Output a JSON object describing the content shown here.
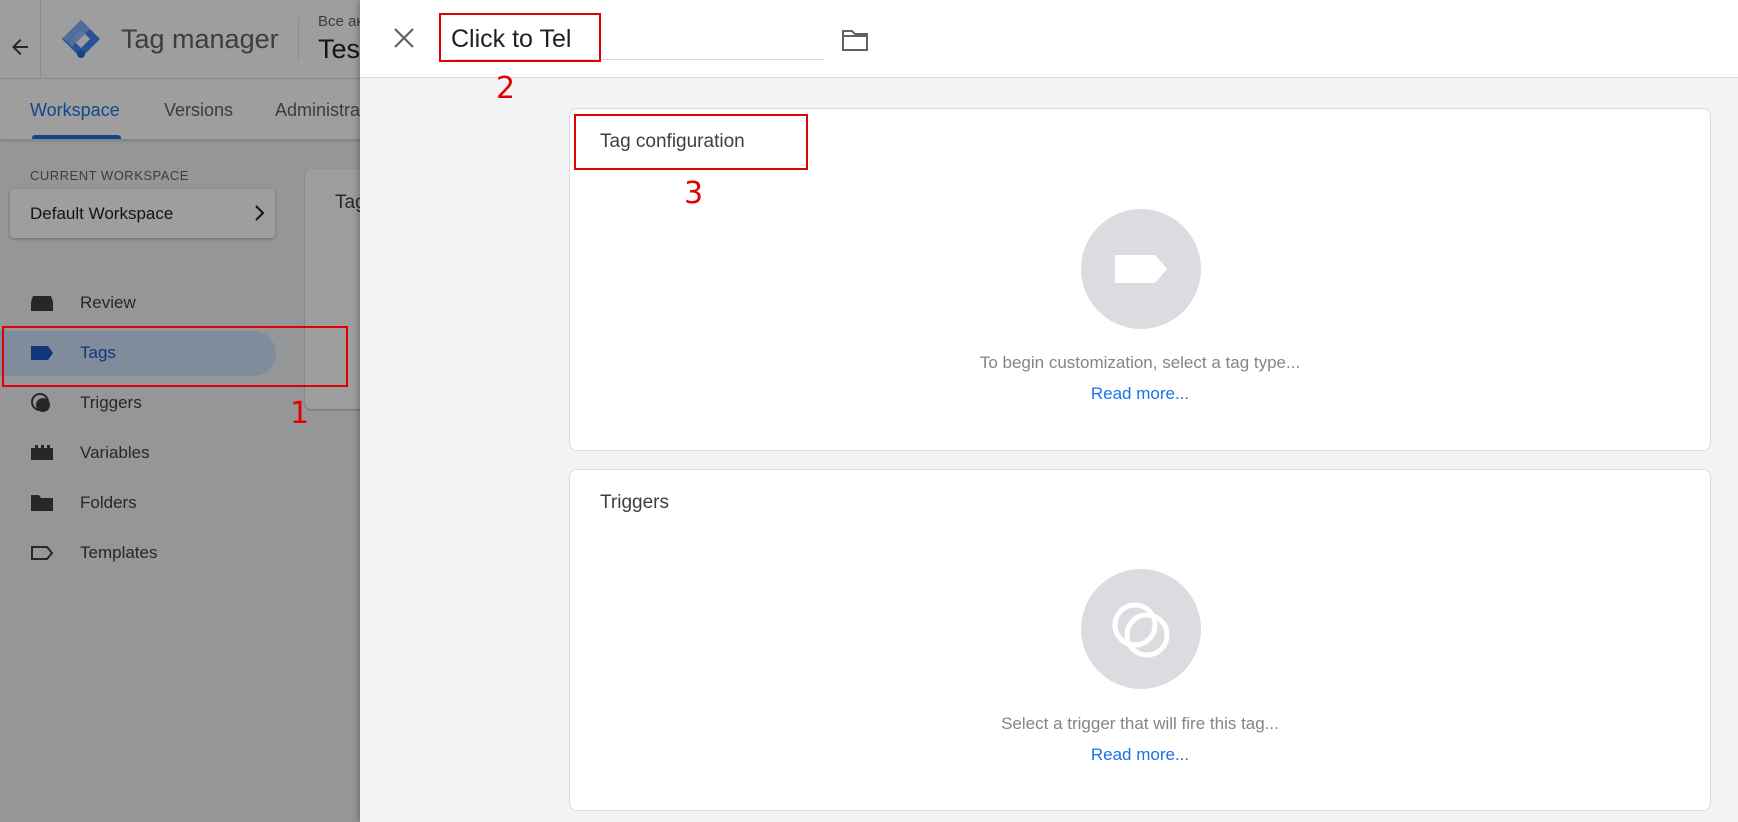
{
  "app": {
    "name": "Tag manager",
    "account_small": "Все ак",
    "account_big": "Tes"
  },
  "tabs": [
    {
      "label": "Workspace",
      "active": true
    },
    {
      "label": "Versions",
      "active": false
    },
    {
      "label": "Administra",
      "active": false
    }
  ],
  "workspace": {
    "label": "CURRENT WORKSPACE",
    "name": "Default Workspace"
  },
  "nav": [
    {
      "label": "Review",
      "icon": "review-icon"
    },
    {
      "label": "Tags",
      "icon": "tag-icon",
      "active": true
    },
    {
      "label": "Triggers",
      "icon": "trigger-icon"
    },
    {
      "label": "Variables",
      "icon": "variables-icon"
    },
    {
      "label": "Folders",
      "icon": "folder-icon"
    },
    {
      "label": "Templates",
      "icon": "template-icon"
    }
  ],
  "bg_card": {
    "title": "Tag"
  },
  "editor": {
    "tag_name": "Click to Tel",
    "tag_config": {
      "title": "Tag configuration",
      "hint": "To begin customization, select a tag type...",
      "link": "Read more..."
    },
    "triggers": {
      "title": "Triggers",
      "hint": "Select a trigger that will fire this tag...",
      "link": "Read more..."
    }
  },
  "annotations": [
    "1",
    "2",
    "3"
  ],
  "colors": {
    "accent": "#1a73e8",
    "annotation": "#e20000"
  }
}
